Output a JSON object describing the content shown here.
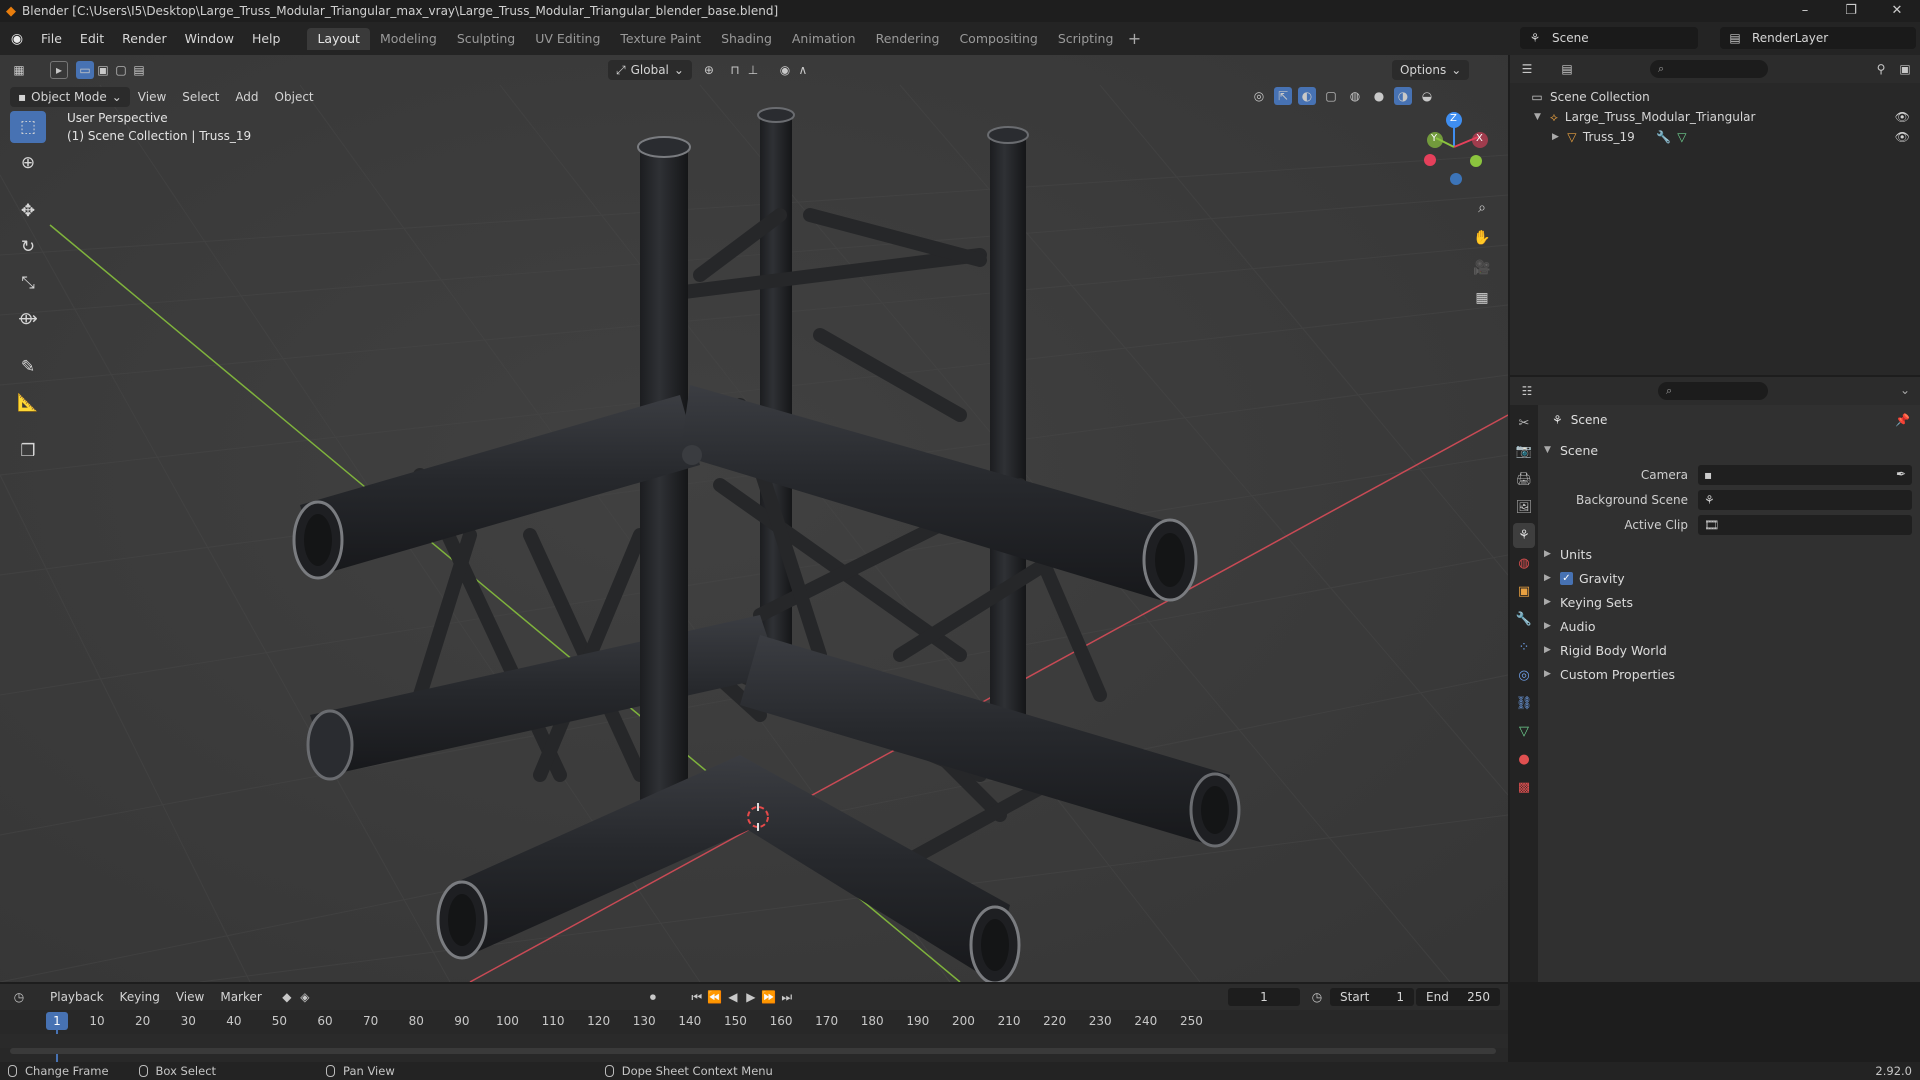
{
  "window": {
    "title": "Blender [C:\\Users\\I5\\Desktop\\Large_Truss_Modular_Triangular_max_vray\\Large_Truss_Modular_Triangular_blender_base.blend]",
    "minimize": "–",
    "maximize": "❐",
    "close": "✕"
  },
  "menu": [
    "File",
    "Edit",
    "Render",
    "Window",
    "Help"
  ],
  "workspaces": [
    "Layout",
    "Modeling",
    "Sculpting",
    "UV Editing",
    "Texture Paint",
    "Shading",
    "Animation",
    "Rendering",
    "Compositing",
    "Scripting"
  ],
  "active_workspace": "Layout",
  "scene_selector": "Scene",
  "render_layer": "RenderLayer",
  "viewport": {
    "mode": "Object Mode",
    "menus": [
      "View",
      "Select",
      "Add",
      "Object"
    ],
    "transform_orientation": "Global",
    "options_label": "Options",
    "info_line1": "User Perspective",
    "info_line2": "(1) Scene Collection | Truss_19",
    "gizmo_axes": {
      "x": "X",
      "y": "Y",
      "z": "Z"
    }
  },
  "outliner": {
    "root": "Scene Collection",
    "items": [
      {
        "label": "Large_Truss_Modular_Triangular"
      },
      {
        "label": "Truss_19"
      }
    ]
  },
  "properties": {
    "title": "Scene",
    "section": "Scene",
    "fields": [
      {
        "label": "Camera",
        "value": ""
      },
      {
        "label": "Background Scene",
        "value": ""
      },
      {
        "label": "Active Clip",
        "value": ""
      }
    ],
    "panels": [
      "Units",
      "Gravity",
      "Keying Sets",
      "Audio",
      "Rigid Body World",
      "Custom Properties"
    ],
    "gravity_enabled": true
  },
  "timeline": {
    "menus": [
      "Playback",
      "Keying",
      "View",
      "Marker"
    ],
    "current_frame": "1",
    "start_label": "Start",
    "start": "1",
    "end_label": "End",
    "end": "250",
    "ticks": [
      "1",
      "10",
      "20",
      "30",
      "40",
      "50",
      "60",
      "70",
      "80",
      "90",
      "100",
      "110",
      "120",
      "130",
      "140",
      "150",
      "160",
      "170",
      "180",
      "190",
      "200",
      "210",
      "220",
      "230",
      "240",
      "250"
    ]
  },
  "statusbar": {
    "items": [
      "Change Frame",
      "Box Select",
      "Pan View",
      "Dope Sheet Context Menu"
    ],
    "version": "2.92.0"
  },
  "colors": {
    "accent": "#4772b3",
    "brand": "#e87d0d",
    "x_axis": "#e5405b",
    "y_axis": "#8bc43e",
    "z_axis": "#3f8ef0"
  }
}
